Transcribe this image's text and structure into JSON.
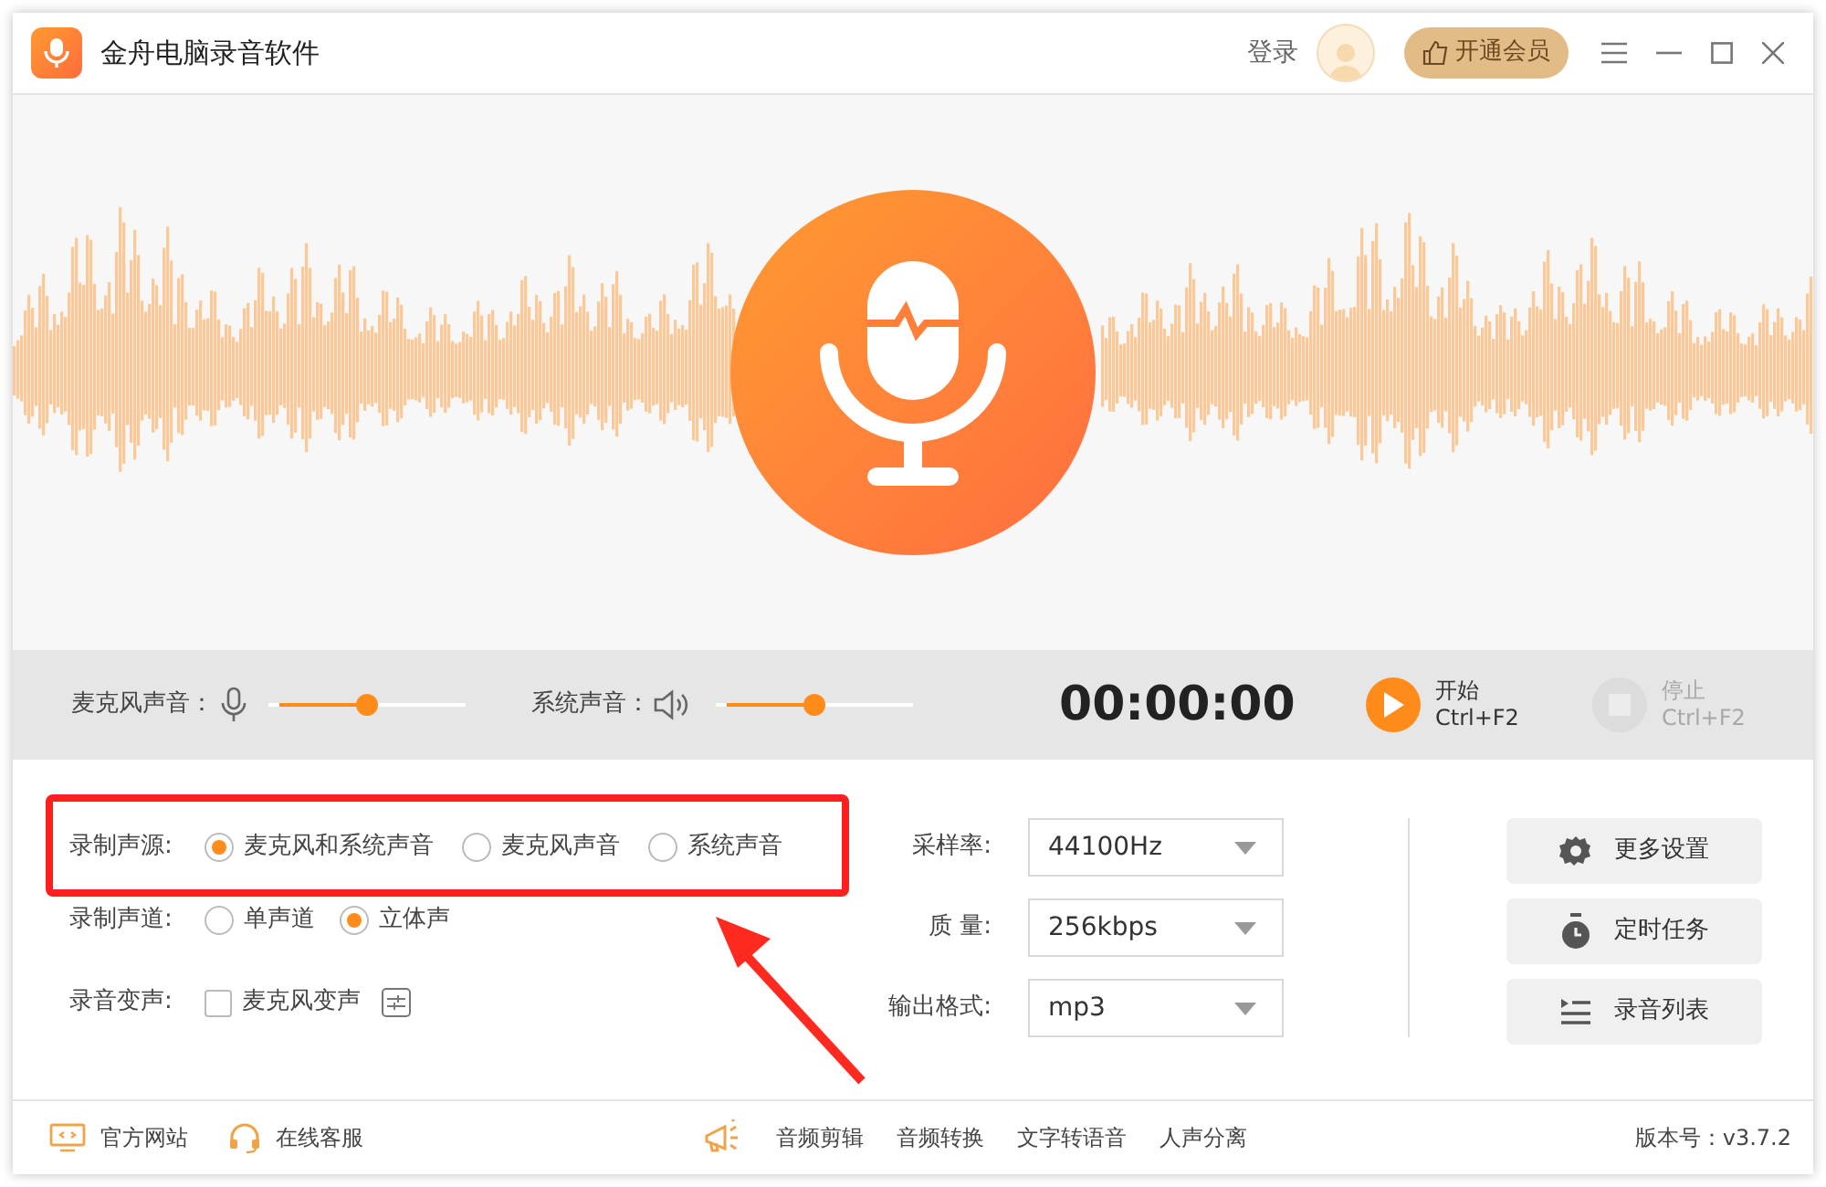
{
  "window": {
    "title": "金舟电脑录音软件",
    "login": "登录",
    "vip_button": "开通会员"
  },
  "controls": {
    "mic": {
      "label": "麦克风声音：",
      "level": 0.5
    },
    "system": {
      "label": "系统声音：",
      "level": 0.5
    },
    "timer": "00:00:00",
    "actions": [
      {
        "kind": "start",
        "label": "开始",
        "shortcut": "Ctrl+F2",
        "disabled": false
      },
      {
        "kind": "stop",
        "label": "停止",
        "shortcut": "Ctrl+F2",
        "disabled": true
      }
    ]
  },
  "source": {
    "label": "录制声源:",
    "options": [
      {
        "label": "麦克风和系统声音",
        "selected": true
      },
      {
        "label": "麦克风声音",
        "selected": false
      },
      {
        "label": "系统声音",
        "selected": false
      }
    ]
  },
  "channel": {
    "label": "录制声道:",
    "options": [
      {
        "label": "单声道",
        "selected": false
      },
      {
        "label": "立体声",
        "selected": true
      }
    ]
  },
  "voice_change": {
    "label": "录音变声:",
    "option": "麦克风变声",
    "checked": false
  },
  "selects": [
    {
      "label": "采样率:",
      "value": "44100Hz"
    },
    {
      "label": "质 量:",
      "value": "256kbps"
    },
    {
      "label": "输出格式:",
      "value": "mp3"
    }
  ],
  "buttons": [
    {
      "kind": "settings",
      "label": "更多设置"
    },
    {
      "kind": "timer",
      "label": "定时任务"
    },
    {
      "kind": "list",
      "label": "录音列表"
    }
  ],
  "footer": {
    "left": [
      {
        "kind": "web",
        "label": "官方网站"
      },
      {
        "kind": "service",
        "label": "在线客服"
      }
    ],
    "tools": [
      "音频剪辑",
      "音频转换",
      "文字转语音",
      "人声分离"
    ],
    "version": "版本号：v3.7.2"
  }
}
